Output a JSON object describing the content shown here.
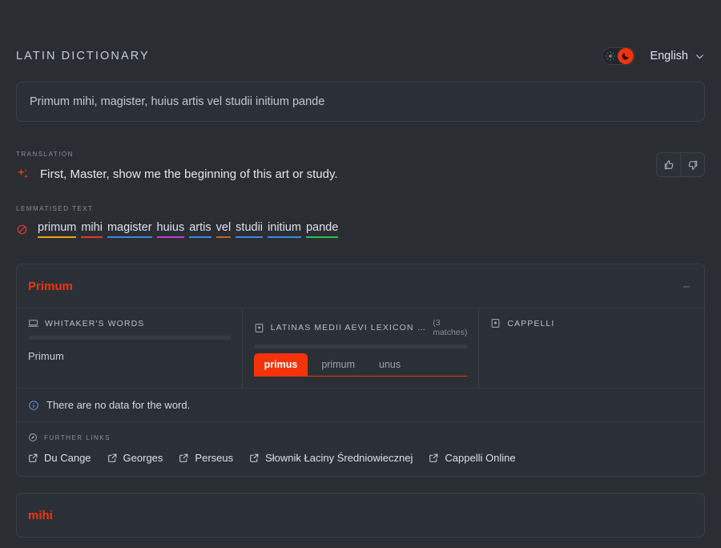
{
  "header": {
    "app_title": "LATIN DICTIONARY",
    "theme_toggle": {
      "sun_icon": "sun-icon",
      "moon_icon": "moon-icon",
      "active": "dark"
    },
    "language": {
      "label": "English",
      "chevron_icon": "chevron-down-icon"
    }
  },
  "search": {
    "value": "Primum mihi, magister, huius artis vel studii initium pande",
    "placeholder": "Primum mihi, magister, huius artis vel studii initium pande"
  },
  "translation": {
    "label": "TRANSLATION",
    "icon": "sparkles-icon",
    "text": "First, Master, show me the beginning of this art or study.",
    "feedback": {
      "thumbs_up_icon": "thumbs-up-icon",
      "thumbs_down_icon": "thumbs-down-icon"
    }
  },
  "lemmatised": {
    "label": "LEMMATISED TEXT",
    "icon": "slashed-circle-icon",
    "tokens": [
      {
        "text": "primum",
        "color": "#e8a317"
      },
      {
        "text": "mihi",
        "color": "#e03a2f"
      },
      {
        "text": "magister",
        "color": "#3d88d8"
      },
      {
        "text": "huius",
        "color": "#c43ed8"
      },
      {
        "text": "artis",
        "color": "#3d88d8"
      },
      {
        "text": "vel",
        "color": "#c0671f"
      },
      {
        "text": "studii",
        "color": "#3d88d8"
      },
      {
        "text": "initium",
        "color": "#3d88d8"
      },
      {
        "text": "pande",
        "color": "#2fbf4f"
      }
    ]
  },
  "cards": [
    {
      "title": "Primum",
      "minimize_label": "–",
      "columns": [
        {
          "icon": "monitor-icon",
          "title": "WHITAKER'S WORDS",
          "matches": "",
          "entries": [
            "Primum"
          ],
          "chips": []
        },
        {
          "icon": "book-icon",
          "title": "LATINAS MEDII AEVI LEXICON …",
          "matches": "(3 matches)",
          "entries": [],
          "chips": [
            {
              "label": "primus",
              "active": true
            },
            {
              "label": "primum",
              "active": false
            },
            {
              "label": "unus",
              "active": false
            }
          ]
        },
        {
          "icon": "book-icon",
          "title": "CAPPELLI",
          "matches": "",
          "entries": [],
          "chips": []
        }
      ],
      "notice": {
        "icon": "info-icon",
        "text": "There are no data for the word."
      },
      "further_links": {
        "icon": "compass-icon",
        "label": "FURTHER LINKS",
        "items": [
          {
            "label": "Du Cange",
            "icon": "external-link-icon"
          },
          {
            "label": "Georges",
            "icon": "external-link-icon"
          },
          {
            "label": "Perseus",
            "icon": "external-link-icon"
          },
          {
            "label": "Słownik Łaciny Średniowiecznej",
            "icon": "external-link-icon"
          },
          {
            "label": "Cappelli Online",
            "icon": "external-link-icon"
          }
        ]
      }
    },
    {
      "title": "mihi",
      "minimize_label": "–"
    }
  ],
  "colors": {
    "page_bg": "#2a2e33",
    "card_bg": "#2b3036",
    "accent": "#f4330c",
    "border": "#3a4049",
    "text": "#dfe3e8",
    "muted": "#8b9099",
    "info_blue": "#5b8fd0"
  }
}
